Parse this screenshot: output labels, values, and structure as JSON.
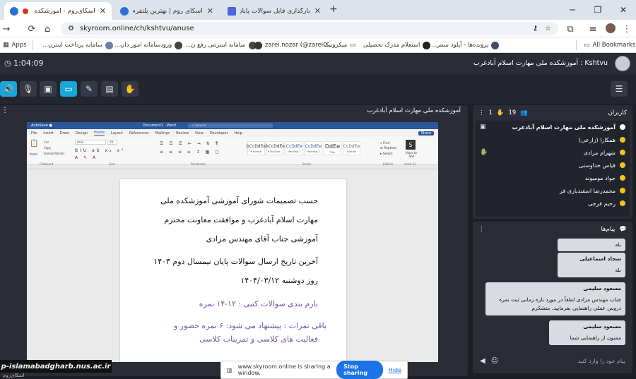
{
  "browser": {
    "tabs": [
      {
        "title": "اسکای‌روم - آموزشکده ملی مه",
        "active": true
      },
      {
        "title": "اسکای روم | بهترین پلتفرم برگزاری",
        "active": false
      },
      {
        "title": "بارگذاری فایل سوالات پایان نیمسا",
        "active": false
      }
    ],
    "url": "skyroom.online/ch/kshtvu/anuse",
    "bookmarks": {
      "apps": "Apps",
      "all": "All Bookmarks",
      "items": [
        "سامانه پرداخت اینترن...",
        "ورودسامانه امور دان...",
        "سامانه اینترنتی رفع ن...",
        "zarei.nozar (@zarei0...",
        "میکروتیک",
        "استعلام مدرک تحصیلی",
        "پرونده‌ها - آپلود سنتر..."
      ]
    }
  },
  "room": {
    "timer": "1:04:09",
    "title": "آموزشکده ملی مهارت اسلام آبادغرب",
    "owner_handle": "Kshtvu"
  },
  "share": {
    "title": "آموزشکده ملی مهارت اسلام آبادغرب"
  },
  "word": {
    "doc_title": "Document1 - Word",
    "search": "Search",
    "tabs": [
      "File",
      "Insert",
      "Draw",
      "Design",
      "Home",
      "Layout",
      "References",
      "Mailings",
      "Review",
      "View",
      "Developer",
      "Help"
    ],
    "active_tab": "Home",
    "share": "Share",
    "font_name": "Arial",
    "font_size": "20",
    "clipboard": {
      "paste": "Paste",
      "cut": "Cut",
      "copy": "Copy",
      "format_painter": "Format Painter"
    },
    "groups": {
      "clipboard": "Clipboard",
      "font": "Font",
      "paragraph": "Paragraph",
      "styles": "Styles",
      "editing": "Editing",
      "voice": "Voice AI"
    },
    "styles": [
      {
        "sample": "bCcDdEe",
        "name": "¶ Normal"
      },
      {
        "sample": "bCcDdEe",
        "name": "¶ No Spac..."
      },
      {
        "sample": "CcDdEe",
        "name": "Heading 1"
      },
      {
        "sample": "CcDdEe",
        "name": "Heading 2"
      },
      {
        "sample": "DdEe",
        "name": "Title"
      },
      {
        "sample": "CcDdEe",
        "name": "Subtitle"
      }
    ],
    "editing": {
      "find": "Find",
      "replace": "Replace",
      "select": "Select"
    },
    "voice": "Voice to Text"
  },
  "document": {
    "lines": [
      "حسب تصمیمات شورای آموزشی آموزشکده ملی",
      "مهارت اسلام آبادغرب و موافقت معاونت محترم",
      "آموزشی جناب آقای مهندس مرادی",
      "آخرین تاریخ ارسال سوالات پایان نیمسال دوم ۱۴۰۳",
      "روز دوشنبه ۱۴۰۴/۰۳/۱۲",
      "بارم بندی سوالات کتبی : ۱۲-۱۴ نمره",
      "باقی نمرات : پیشنهاد می شود: ۶ نمره حضور و",
      "فعالیت های کلاسی و تمرینات کلاسی"
    ]
  },
  "users": {
    "title": "کاربران",
    "count": "19",
    "raised_hands": "1",
    "list": [
      {
        "name": "آموزشکده ملی مهارت اسلام آبادغرب",
        "role": "admin"
      },
      {
        "name": "همکارا (زارعی)",
        "role": "user"
      },
      {
        "name": "شهرام مرادی",
        "role": "user"
      },
      {
        "name": "قیاس خداوستی",
        "role": "user"
      },
      {
        "name": "جواد مومیوند",
        "role": "user"
      },
      {
        "name": "محمدرضا اسفندیاری فر",
        "role": "user"
      },
      {
        "name": "رحیم فرجی",
        "role": "user"
      }
    ]
  },
  "messages": {
    "title": "پیام‌ها",
    "list": [
      {
        "sender": "",
        "text": "بله"
      },
      {
        "sender": "سجاد اسماعیلی",
        "text": "بله"
      },
      {
        "sender": "مسعود سلیمی",
        "text": "جناب مهندس مرادی لطفاً در مورد بازه زمانی ثبت نمره دروس عملی راهنمایی بفرمایید. متشکرم"
      },
      {
        "sender": "مسعود سلیمی",
        "text": "ممنون از راهنمایی شما"
      }
    ],
    "input_placeholder": "پیام خود را وارد کنید"
  },
  "watermark": {
    "text": "p-islamabadgharb.nus.ac.ir",
    "sub": "اسکای‌روم"
  },
  "sharing_notice": {
    "text": "www.skyroom.online is sharing a window.",
    "stop": "Stop sharing",
    "hide": "Hide"
  },
  "colors": {
    "accent": "#19a6d9",
    "user_icon": "#f0c419",
    "doc_purple": "#7b4fa6",
    "word_blue": "#2b579a",
    "chrome_blue": "#1a73e8"
  }
}
